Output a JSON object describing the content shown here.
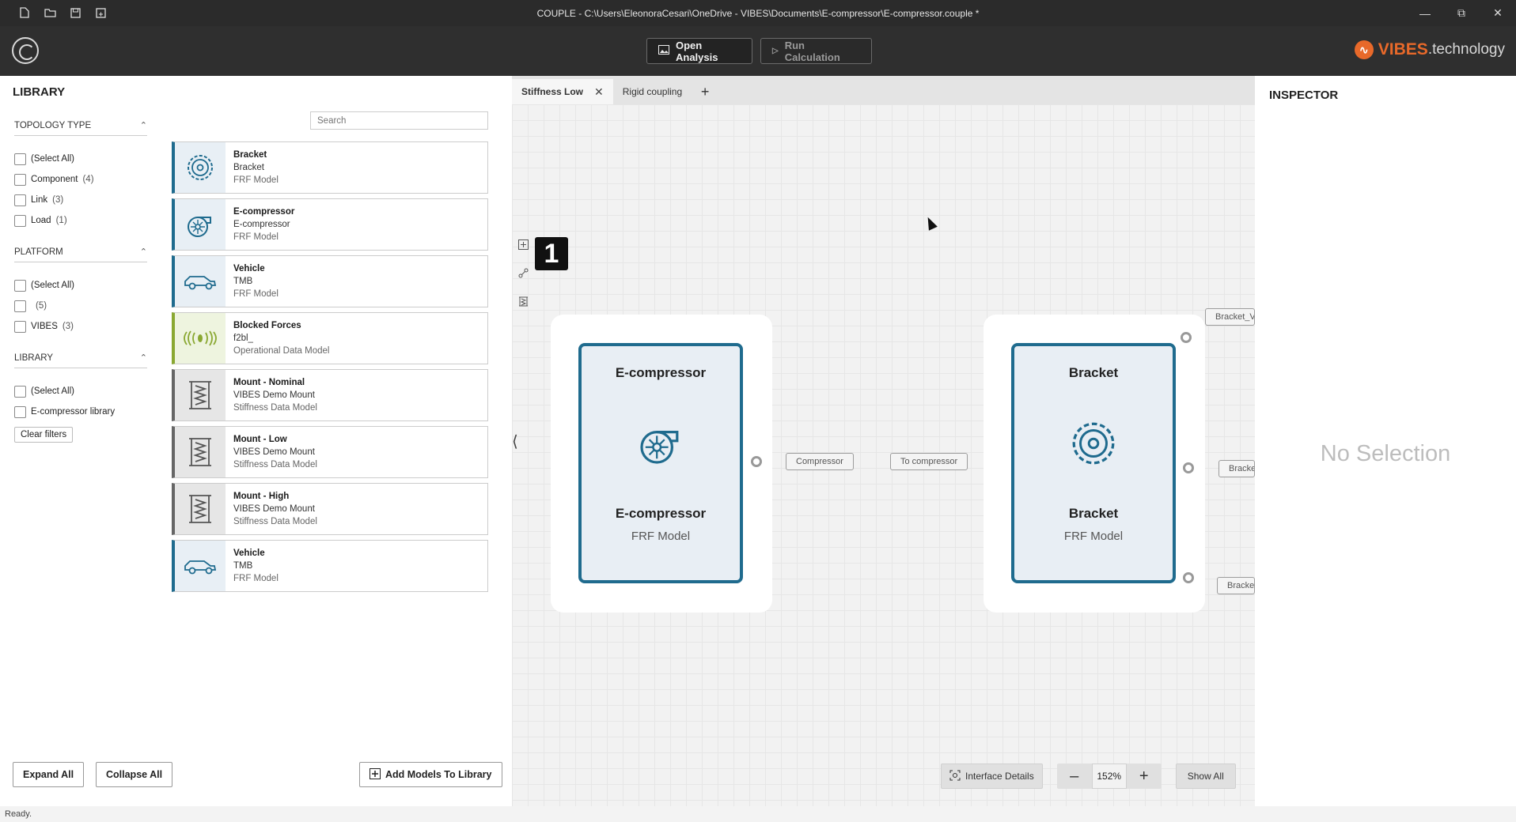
{
  "window": {
    "title": "COUPLE  -  C:\\Users\\EleonoraCesari\\OneDrive - VIBES\\Documents\\E-compressor\\E-compressor.couple *"
  },
  "toolbar": {
    "open_analysis": "Open Analysis",
    "run_calculation": "Run Calculation",
    "brand_main": "VIBES",
    "brand_suffix": ".technology",
    "brand_color": "#e8692a"
  },
  "library": {
    "title": "LIBRARY",
    "search_placeholder": "Search",
    "filters": [
      {
        "heading": "TOPOLOGY TYPE",
        "options": [
          {
            "label": "(Select All)",
            "count": ""
          },
          {
            "label": "Component",
            "count": "(4)"
          },
          {
            "label": "Link",
            "count": "(3)"
          },
          {
            "label": "Load",
            "count": "(1)"
          }
        ]
      },
      {
        "heading": "PLATFORM",
        "options": [
          {
            "label": "(Select All)",
            "count": ""
          },
          {
            "label": "",
            "count": "(5)"
          },
          {
            "label": "VIBES",
            "count": "(3)"
          }
        ]
      },
      {
        "heading": "LIBRARY",
        "options": [
          {
            "label": "(Select All)",
            "count": ""
          },
          {
            "label": "E-compressor library",
            "count": ""
          }
        ]
      }
    ],
    "clear_filters": "Clear filters",
    "cards": [
      {
        "name": "Bracket",
        "sub": "Bracket",
        "type": "FRF Model",
        "icon": "gear-icon"
      },
      {
        "name": "E-compressor",
        "sub": "E-compressor",
        "type": "FRF Model",
        "icon": "turbo-icon"
      },
      {
        "name": "Vehicle",
        "sub": "TMB",
        "type": "FRF Model",
        "icon": "car-icon"
      },
      {
        "name": "Blocked Forces",
        "sub": "f2bl_",
        "type": "Operational Data Model",
        "icon": "vibration-icon"
      },
      {
        "name": "Mount - Nominal",
        "sub": "VIBES Demo Mount",
        "type": "Stiffness Data Model",
        "icon": "spring-icon"
      },
      {
        "name": "Mount - Low",
        "sub": "VIBES Demo Mount",
        "type": "Stiffness Data Model",
        "icon": "spring-icon"
      },
      {
        "name": "Mount - High",
        "sub": "VIBES Demo Mount",
        "type": "Stiffness Data Model",
        "icon": "spring-icon"
      },
      {
        "name": "Vehicle",
        "sub": "TMB",
        "type": "FRF Model",
        "icon": "car-icon"
      }
    ],
    "expand_all": "Expand All",
    "collapse_all": "Collapse All",
    "add_models": "Add Models To Library"
  },
  "canvas": {
    "tabs": [
      {
        "label": "Stiffness Low",
        "active": true
      },
      {
        "label": "Rigid coupling",
        "active": false
      }
    ],
    "step_badge": "1",
    "nodes": [
      {
        "title": "E-compressor",
        "name": "E-compressor",
        "type": "FRF Model",
        "icon": "turbo-icon"
      },
      {
        "title": "Bracket",
        "name": "Bracket",
        "type": "FRF Model",
        "icon": "gear-icon"
      }
    ],
    "connection_labels": [
      "Compressor",
      "To compressor",
      "Bracket_V",
      "Bracke",
      "Bracke"
    ],
    "interface_details": "Interface Details",
    "zoom_value": "152%",
    "show_all": "Show All"
  },
  "inspector": {
    "title": "INSPECTOR",
    "empty_text": "No Selection"
  },
  "status": {
    "text": "Ready."
  }
}
